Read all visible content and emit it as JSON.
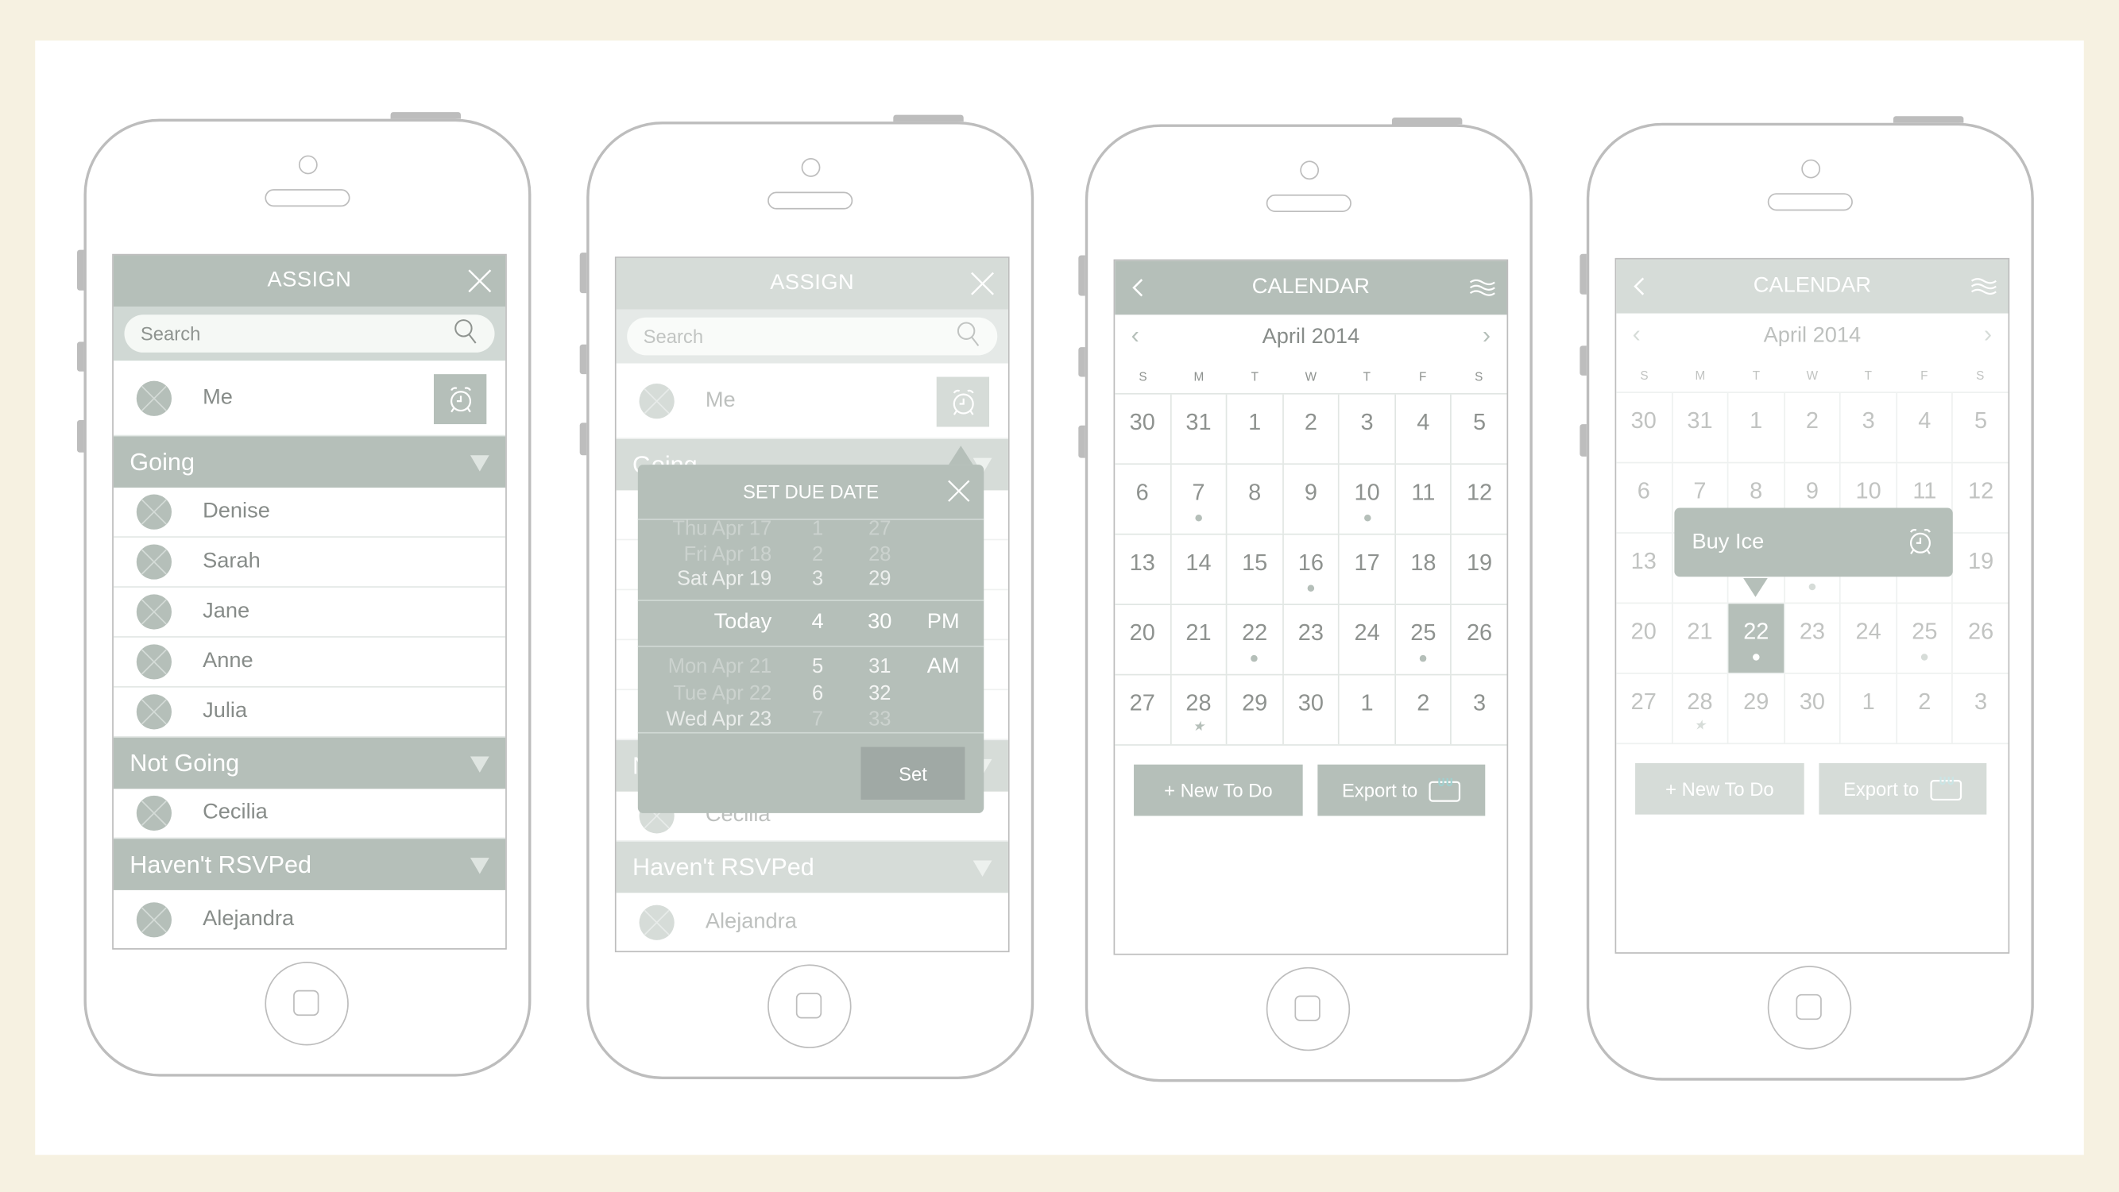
{
  "assign": {
    "title": "ASSIGN",
    "search_placeholder": "Search",
    "me": "Me",
    "sections": [
      {
        "label": "Going",
        "people": [
          "Denise",
          "Sarah",
          "Jane",
          "Anne",
          "Julia"
        ]
      },
      {
        "label": "Not Going",
        "people": [
          "Cecilia"
        ]
      },
      {
        "label": "Haven't RSVPed",
        "people": [
          "Alejandra"
        ]
      }
    ]
  },
  "due_date_popup": {
    "title": "SET DUE DATE",
    "days": [
      "Thu Apr 17",
      "Fri Apr 18",
      "Sat Apr 19",
      "Today",
      "Mon Apr 21",
      "Tue Apr 22",
      "Wed Apr 23"
    ],
    "hours": [
      "1",
      "2",
      "3",
      "4",
      "5",
      "6",
      "7"
    ],
    "minutes": [
      "27",
      "28",
      "29",
      "30",
      "31",
      "32",
      "33"
    ],
    "meridiem": [
      "PM",
      "AM"
    ],
    "selected": {
      "day": "Today",
      "hour": "4",
      "minute": "30",
      "meridiem": "PM"
    },
    "set_label": "Set"
  },
  "calendar": {
    "title": "CALENDAR",
    "month": "April 2014",
    "weekdays": [
      "S",
      "M",
      "T",
      "W",
      "T",
      "F",
      "S"
    ],
    "weeks": [
      [
        "30",
        "31",
        "1",
        "2",
        "3",
        "4",
        "5"
      ],
      [
        "6",
        "7",
        "8",
        "9",
        "10",
        "11",
        "12"
      ],
      [
        "13",
        "14",
        "15",
        "16",
        "17",
        "18",
        "19"
      ],
      [
        "20",
        "21",
        "22",
        "23",
        "24",
        "25",
        "26"
      ],
      [
        "27",
        "28",
        "29",
        "30",
        "1",
        "2",
        "3"
      ]
    ],
    "markers": {
      "7": "dot",
      "10": "dot",
      "16": "dot",
      "22": "dot",
      "25": "dot",
      "28": "star"
    },
    "selected_day": "22",
    "new_todo_label": "+ New To Do",
    "export_label": "Export to"
  },
  "event_popup": {
    "title": "Buy Ice",
    "icon": "alarm-clock-icon"
  },
  "colors": {
    "accent": "#b5bfb9",
    "background": "#f6f1e1",
    "text": "#878c89",
    "button_dark": "#a0a9a5"
  }
}
